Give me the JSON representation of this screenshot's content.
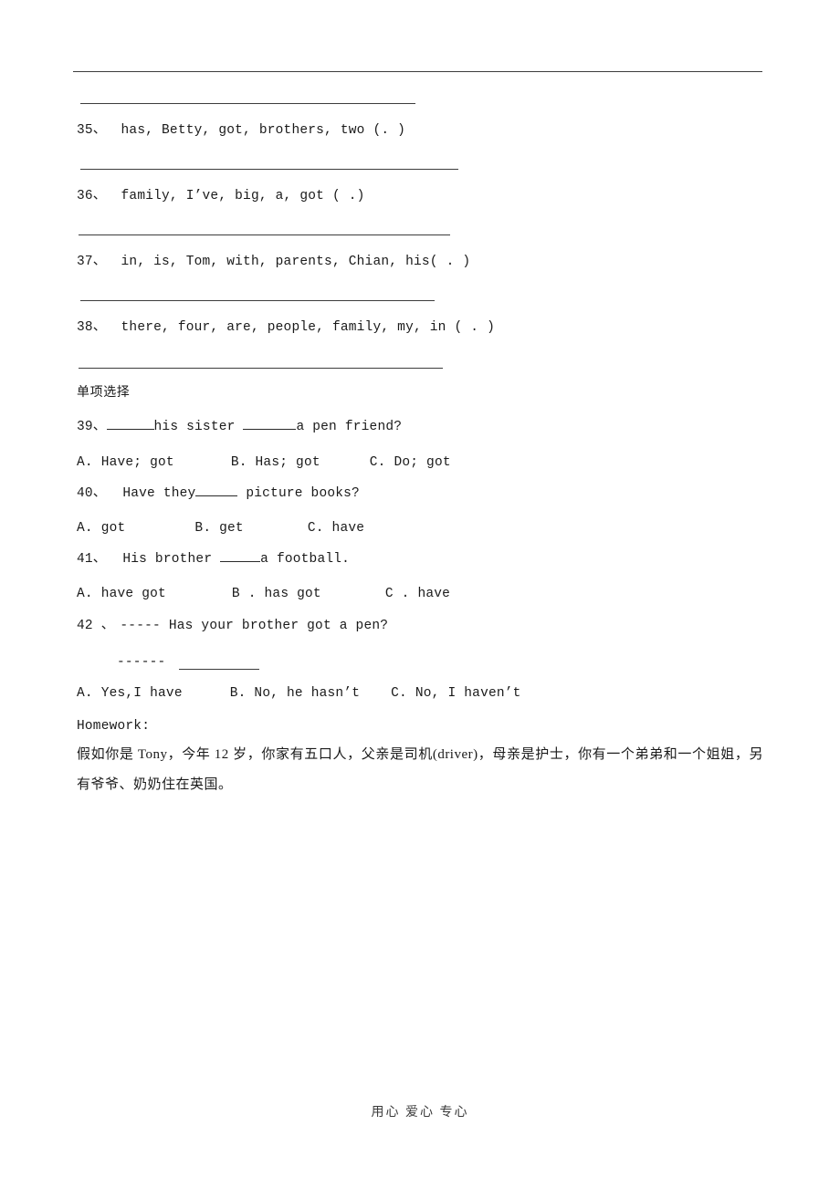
{
  "document": {
    "footer_text": "用心  爱心  专心",
    "rule_color": "#3c3c3c"
  },
  "reorder_questions": [
    {
      "number": "35、",
      "text": "has, Betty, got, brothers, two (. )"
    },
    {
      "number": "36、",
      "text": "family, I’ve, big, a, got ( .)"
    },
    {
      "number": "37、",
      "text": "in, is, Tom, with, parents, Chian, his( . )"
    },
    {
      "number": "38、",
      "text": "there, four, are, people, family, my, in ( . )"
    }
  ],
  "section_heading": "单项选择",
  "choice_questions": [
    {
      "number": "39、",
      "stem_part1": "",
      "stem_part2": "his sister ",
      "stem_part3": "a pen friend?",
      "options": [
        {
          "label": "A. Have; got"
        },
        {
          "label": "B. Has; got"
        },
        {
          "label": "C. Do; got"
        }
      ]
    },
    {
      "number": "40、",
      "stem_part1": "  Have they",
      "stem_part2": " picture books?",
      "options": [
        {
          "label": "A. got"
        },
        {
          "label": "B. get"
        },
        {
          "label": "C. have"
        }
      ]
    },
    {
      "number": "41、",
      "stem_part1": "  His brother ",
      "stem_part2": "a football.",
      "options": [
        {
          "label": "A. have got"
        },
        {
          "label": "B . has got"
        },
        {
          "label": "C . have"
        }
      ]
    },
    {
      "number": "42 、",
      "stem_part1": "----- Has your brother got a pen?",
      "stem_part2": "------",
      "options": [
        {
          "label": "A. Yes,I have"
        },
        {
          "label": "B. No, he hasn’t"
        },
        {
          "label": "C. No, I haven’t"
        }
      ]
    }
  ],
  "homework": {
    "label": "Homework:",
    "paragraph": "假如你是 Tony，今年 12 岁，你家有五口人，父亲是司机(driver)，母亲是护士，你有一个弟弟和一个姐姐，另有爷爷、奶奶住在英国。"
  }
}
